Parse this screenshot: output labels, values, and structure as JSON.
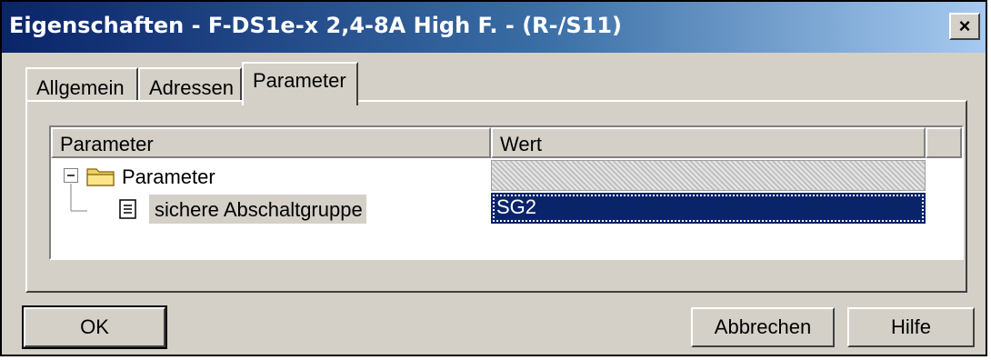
{
  "window": {
    "title": "Eigenschaften - F-DS1e-x 2,4-8A High F. - (R-/S11)",
    "close_glyph": "×"
  },
  "tabs": [
    {
      "label": "Allgemein",
      "active": false
    },
    {
      "label": "Adressen",
      "active": false
    },
    {
      "label": "Parameter",
      "active": true
    }
  ],
  "grid": {
    "columns": [
      "Parameter",
      "Wert"
    ],
    "rows": [
      {
        "label": "Parameter",
        "value": "",
        "icon": "folder-icon",
        "expanded": true
      },
      {
        "label": "sichere Abschaltgruppe",
        "value": "SG2",
        "icon": "document-icon",
        "selected": true
      }
    ]
  },
  "buttons": {
    "ok": "OK",
    "cancel": "Abbrechen",
    "help": "Hilfe"
  }
}
